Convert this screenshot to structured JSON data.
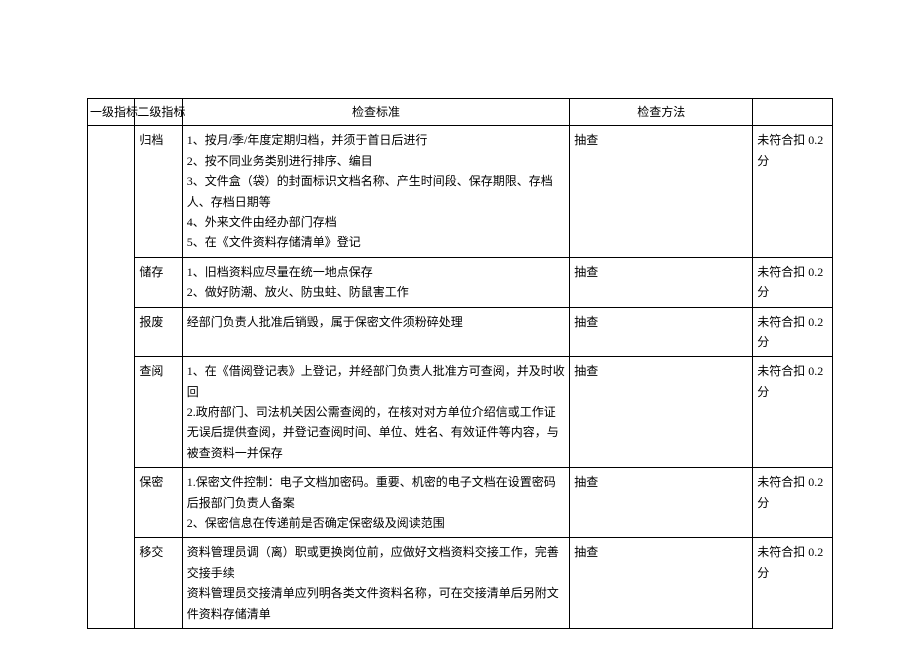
{
  "headers": {
    "c1": "一级指标",
    "c2": "二级指标",
    "c3": "检查标准",
    "c4": "检查方法",
    "c5": ""
  },
  "rows": [
    {
      "c2": "归档",
      "c3": "1、按月/季/年度定期归档，并须于首日后进行\n2、按不同业务类别进行排序、编目\n3、文件盒（袋）的封面标识文档名称、产生时间段、保存期限、存档人、存档日期等\n4、外来文件由经办部门存档\n5、在《文件资料存储清单》登记",
      "c4": "抽查",
      "c5": "未符合扣 0.2 分"
    },
    {
      "c2": "储存",
      "c3": "1、旧档资料应尽量在统一地点保存\n2、做好防潮、放火、防虫蛀、防鼠害工作",
      "c4": "抽查",
      "c5": "未符合扣 0.2 分"
    },
    {
      "c2": "报废",
      "c3": "经部门负责人批准后销毁，属于保密文件须粉碎处理",
      "c4": "抽查",
      "c5": "未符合扣 0.2 分"
    },
    {
      "c2": "查阅",
      "c3": "1、在《借阅登记表》上登记，并经部门负责人批准方可查阅，并及时收回\n2.政府部门、司法机关因公需查阅的，在核对对方单位介绍信或工作证无误后提供查阅，并登记查阅时间、单位、姓名、有效证件等内容，与被查资料一并保存",
      "c4": "抽查",
      "c5": "未符合扣 0.2 分"
    },
    {
      "c2": "保密",
      "c3": "1.保密文件控制：电子文档加密码。重要、机密的电子文档在设置密码后报部门负责人备案\n2、保密信息在传递前是否确定保密级及阅读范围",
      "c4": "抽查",
      "c5": "未符合扣 0.2 分"
    },
    {
      "c2": "移交",
      "c3": "资料管理员调（离）职或更换岗位前，应做好文档资料交接工作，完善交接手续\n资料管理员交接清单应列明各类文件资料名称，可在交接清单后另附文件资料存储清单",
      "c4": "抽查",
      "c5": "未符合扣 0.2 分"
    }
  ]
}
